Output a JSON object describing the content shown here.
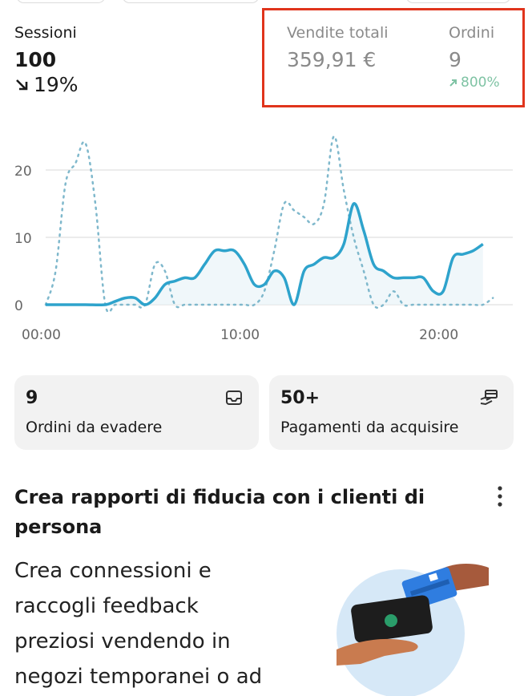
{
  "metrics": {
    "sessions": {
      "label": "Sessioni",
      "value": "100",
      "change": "19%"
    },
    "sales": {
      "label": "Vendite totali",
      "value": "359,91 €"
    },
    "orders": {
      "label": "Ordini",
      "value": "9",
      "change": "800%"
    }
  },
  "chart_data": {
    "type": "line",
    "x_ticks": [
      "00:00",
      "10:00",
      "20:00"
    ],
    "y_ticks": [
      "0",
      "10",
      "20"
    ],
    "ylim": [
      0,
      25
    ],
    "xlim": [
      0,
      23.5
    ],
    "grid": true,
    "series": [
      {
        "style": "solid",
        "color": "#2ea3cc",
        "x": [
          0,
          1,
          2,
          3,
          3.5,
          4,
          4.5,
          5,
          5.5,
          6,
          6.5,
          7,
          7.5,
          8,
          8.5,
          9,
          9.5,
          10,
          10.5,
          11,
          11.5,
          12,
          12.5,
          13,
          13.5,
          14,
          14.5,
          15,
          15.5,
          16,
          16.5,
          17,
          17.5,
          18,
          18.5,
          19,
          19.5,
          20,
          20.5,
          21,
          21.5,
          22
        ],
        "y": [
          0,
          0,
          0,
          0,
          0.5,
          1,
          1,
          0,
          1,
          3,
          3.5,
          4,
          4,
          6,
          8,
          8,
          8,
          6,
          3,
          3,
          5,
          4,
          0,
          5,
          6,
          7,
          7,
          9,
          15,
          11,
          6,
          5,
          4,
          4,
          4,
          4,
          2,
          2,
          7,
          7.5,
          8,
          9
        ]
      },
      {
        "style": "dotted",
        "color": "#7fb8cc",
        "x": [
          0,
          0.5,
          1,
          1.5,
          2,
          2.5,
          3,
          3.5,
          4,
          4.5,
          5,
          5.5,
          6,
          6.5,
          7,
          7.5,
          8,
          8.5,
          9,
          9.5,
          10,
          10.5,
          11,
          11.5,
          12,
          12.5,
          13,
          13.5,
          14,
          14.5,
          15,
          15.5,
          16,
          16.5,
          17,
          17.5,
          18,
          18.5,
          19,
          19.5,
          20,
          20.5,
          21,
          21.5,
          22,
          22.5
        ],
        "y": [
          0,
          5,
          18,
          21,
          24,
          15,
          0,
          0,
          0,
          0,
          0,
          6,
          5,
          0,
          0,
          0,
          0,
          0,
          0,
          0,
          0,
          0,
          2,
          8,
          15,
          14,
          13,
          12,
          15,
          25,
          17,
          10,
          5,
          0,
          0,
          2,
          0,
          0,
          0,
          0,
          0,
          0,
          0,
          0,
          0,
          1
        ]
      }
    ]
  },
  "cards": [
    {
      "value": "9",
      "label": "Ordini da evadere",
      "icon": "inbox-icon"
    },
    {
      "value": "50+",
      "label": "Pagamenti da acquisire",
      "icon": "hand-payment-icon"
    }
  ],
  "promo": {
    "title": "Crea rapporti di fiducia con i clienti di persona",
    "body": "Crea connessioni e raccogli feedback preziosi vendendo in negozi temporanei o ad"
  }
}
